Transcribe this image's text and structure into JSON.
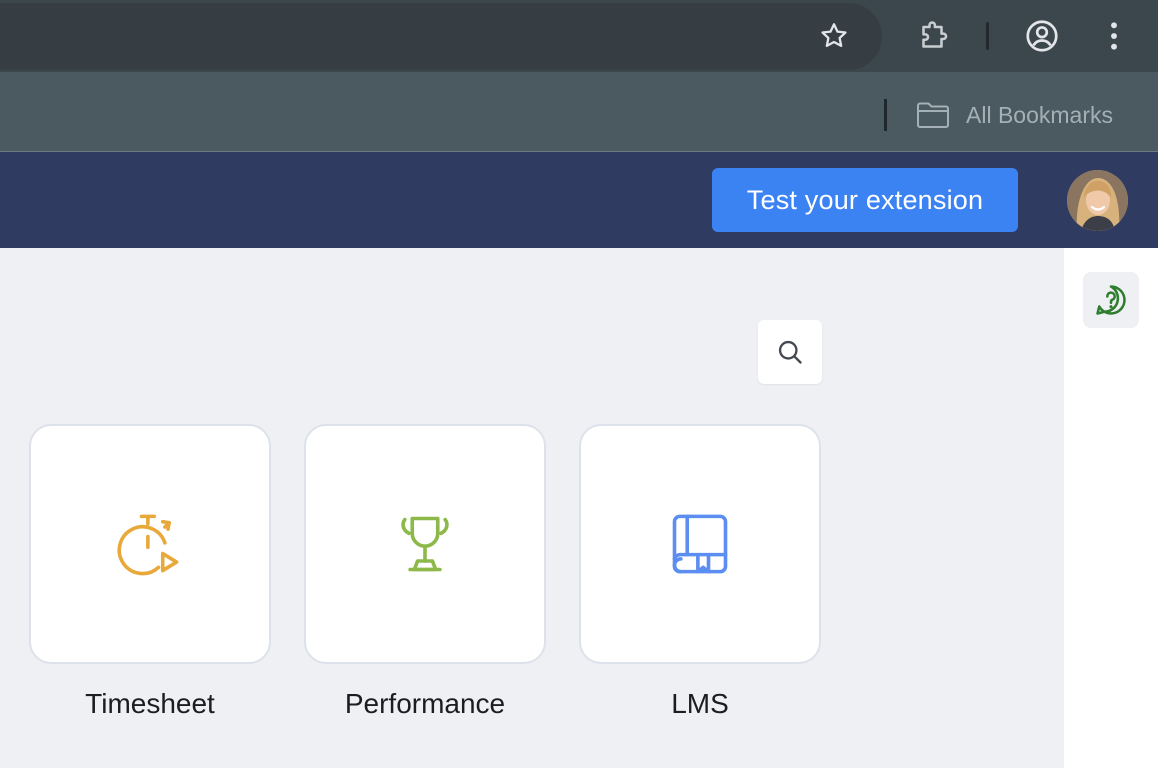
{
  "browser": {
    "icons": {
      "star": "star-icon",
      "extensions": "puzzle-icon",
      "profile": "profile-icon",
      "menu": "kebab-menu-icon"
    },
    "bookmarks_bar": {
      "all_bookmarks_label": "All Bookmarks",
      "folder_icon": "folder-icon"
    }
  },
  "header": {
    "test_extension_label": "Test your extension",
    "accent_color": "#3b82f3",
    "background_color": "#303b62"
  },
  "sidebar": {
    "help_icon": "help-chat-icon"
  },
  "main": {
    "search_icon": "search-icon",
    "apps": [
      {
        "label": "Timesheet",
        "icon": "stopwatch-play-icon",
        "color": "#e8a93a"
      },
      {
        "label": "Performance",
        "icon": "trophy-icon",
        "color": "#8db84a"
      },
      {
        "label": "LMS",
        "icon": "book-icon",
        "color": "#5b8ef0"
      }
    ]
  }
}
